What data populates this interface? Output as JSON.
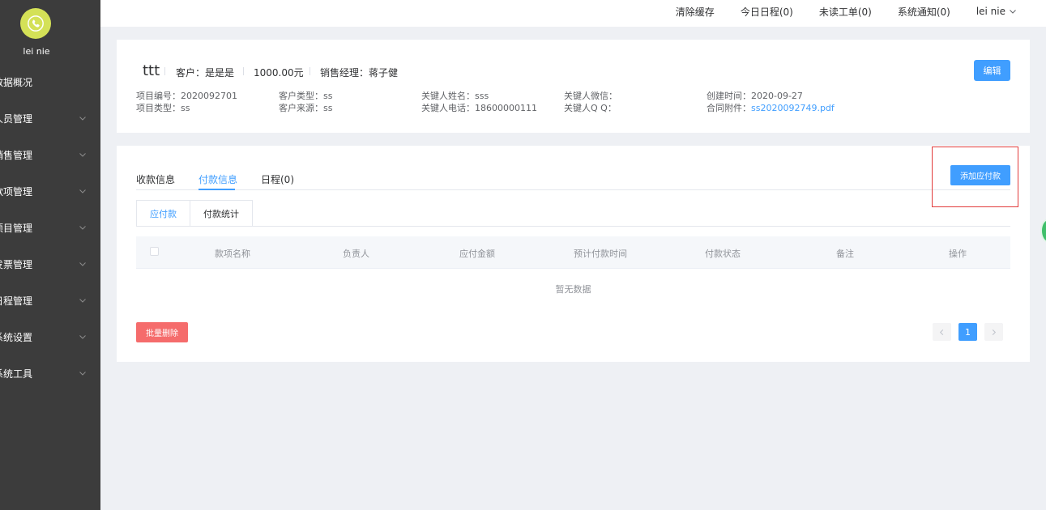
{
  "sidebar": {
    "user_name": "lei nie",
    "items": [
      {
        "label": "数据概况",
        "has_children": false
      },
      {
        "label": "人员管理",
        "has_children": true
      },
      {
        "label": "销售管理",
        "has_children": true
      },
      {
        "label": "款项管理",
        "has_children": true
      },
      {
        "label": "项目管理",
        "has_children": true
      },
      {
        "label": "发票管理",
        "has_children": true
      },
      {
        "label": "日程管理",
        "has_children": true
      },
      {
        "label": "系统设置",
        "has_children": true
      },
      {
        "label": "系统工具",
        "has_children": true
      }
    ]
  },
  "topbar": {
    "clear_cache": "清除缓存",
    "today_schedule": "今日日程(0)",
    "unread_tickets": "未读工单(0)",
    "system_notice": "系统通知(0)",
    "user_name": "lei nie"
  },
  "project": {
    "title": "ttt",
    "customer": "客户：是是是",
    "amount": "1000.00元",
    "sales_manager": "销售经理：蒋子健",
    "edit_label": "编辑",
    "info": {
      "project_no": "项目编号：2020092701",
      "project_type": "项目类型：ss",
      "customer_type": "客户类型：ss",
      "customer_source": "客户来源：ss",
      "key_person_name": "关键人姓名：sss",
      "key_person_phone": "关键人电话：18600000111",
      "key_person_wechat": "关键人微信：",
      "key_person_qq": "关键人Q Q：",
      "created_time": "创建时间：2020-09-27",
      "contract_label": "合同附件：",
      "contract_file": "ss2020092749.pdf"
    }
  },
  "detail": {
    "tabs": [
      {
        "label": "收款信息",
        "active": false
      },
      {
        "label": "付款信息",
        "active": true
      },
      {
        "label": "日程(0)",
        "active": false
      }
    ],
    "add_button": "添加应付款",
    "subtabs": [
      {
        "label": "应付款",
        "active": true
      },
      {
        "label": "付款统计",
        "active": false
      }
    ],
    "table": {
      "columns": [
        "款项名称",
        "负责人",
        "应付金额",
        "预计付款时间",
        "付款状态",
        "备注",
        "操作"
      ],
      "rows": [],
      "empty_text": "暂无数据"
    },
    "batch_delete": "批量删除",
    "pagination": {
      "current_page": "1"
    }
  },
  "colors": {
    "sidebar_bg": "#3c3c3c",
    "primary": "#409eff",
    "danger": "#f56c6c",
    "avatar": "#d4e157",
    "highlight_box": "#e23b3b"
  }
}
